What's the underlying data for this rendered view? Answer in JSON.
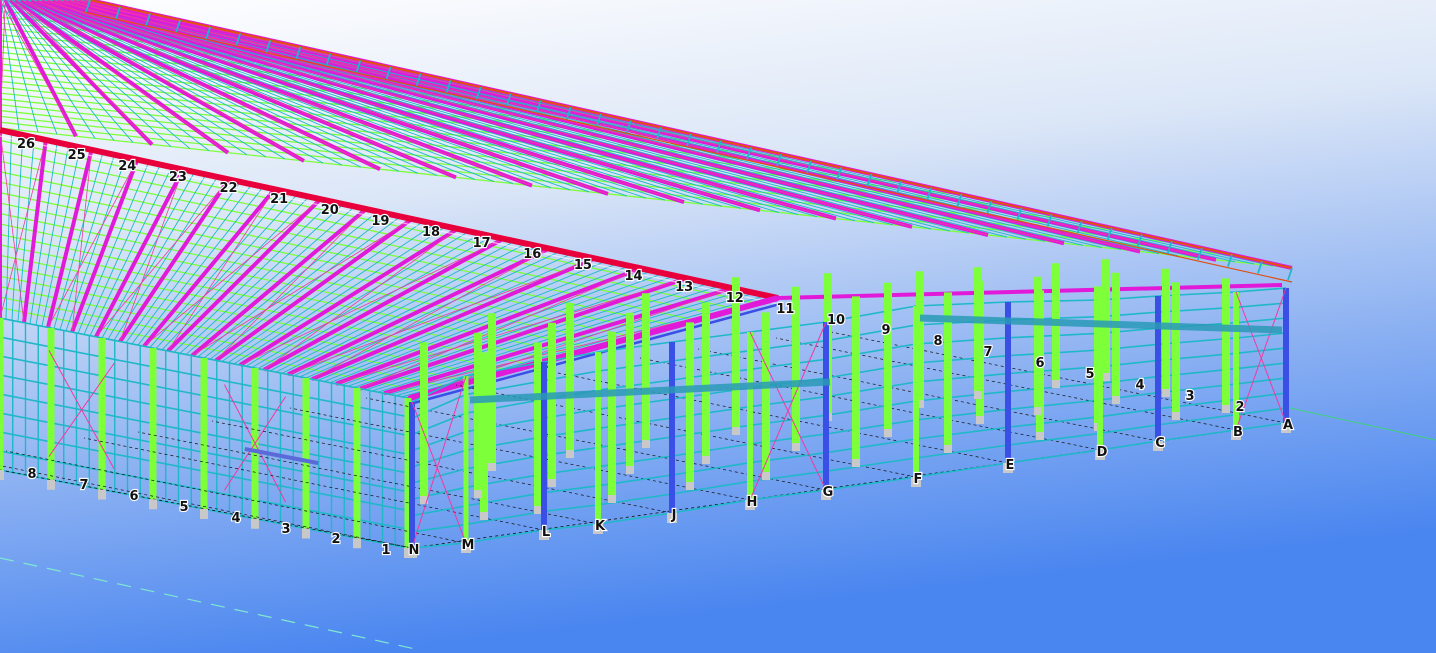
{
  "scene": {
    "background_top": "#ffffff",
    "background_bottom": "#4a86f0",
    "colors": {
      "purlin": "#7dff3a",
      "rafter": "#e01ad8",
      "column": "#3a4fe6",
      "girt": "#1fb8c8",
      "bracing": "#f03aa0",
      "ridge": "#e8003c",
      "edge": "#e05010",
      "footing": "#c8c8c8",
      "gridline": "#111111",
      "reference_line": "#35e060"
    },
    "grid_labels": {
      "ridge_axis": [
        "26",
        "25",
        "24",
        "23",
        "22",
        "21",
        "20",
        "19",
        "18",
        "17",
        "16",
        "15",
        "14",
        "13",
        "12",
        "11",
        "10"
      ],
      "gable_axis": [
        "9",
        "8",
        "7",
        "6",
        "5",
        "4",
        "3",
        "2"
      ],
      "left_axis": [
        "8",
        "7",
        "6",
        "5",
        "4",
        "3",
        "2",
        "1"
      ],
      "letter_axis": [
        "N",
        "M",
        "L",
        "K",
        "J",
        "H",
        "G",
        "F",
        "E",
        "D",
        "C",
        "B",
        "A"
      ]
    }
  }
}
